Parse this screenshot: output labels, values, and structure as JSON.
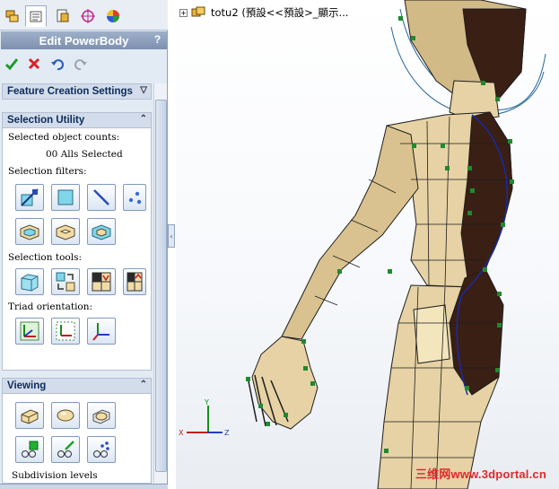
{
  "property_manager": {
    "title": "Edit PowerBody",
    "help_label": "?",
    "tabs": [
      "feature-manager-icon",
      "property-manager-icon",
      "configuration-manager-icon",
      "dimxpert-icon",
      "display-manager-icon"
    ],
    "actions": [
      "ok-icon",
      "cancel-icon",
      "undo-icon",
      "redo-icon"
    ]
  },
  "feature_creation": {
    "header": "Feature Creation Settings"
  },
  "selection_utility": {
    "header": "Selection Utility",
    "counts_label": "Selected object counts:",
    "counts_value": "00 Alls Selected",
    "filters_label": "Selection filters:",
    "filters": [
      "vertex-filter-icon",
      "face-filter-icon",
      "edge-filter-icon",
      "point-filter-icon",
      "select-loop-icon",
      "select-ring-icon",
      "select-grow-icon"
    ],
    "tools_label": "Selection tools:",
    "tools": [
      "select-box-icon",
      "select-swap-icon",
      "select-invert-icon",
      "select-grow-region-icon"
    ],
    "triad_label": "Triad orientation:",
    "triad": [
      "triad-world-icon",
      "triad-local-icon",
      "triad-view-icon"
    ]
  },
  "viewing": {
    "header": "Viewing",
    "buttons": [
      "box-view-icon",
      "smooth-view-icon",
      "both-view-icon",
      "show-vertices-icon",
      "show-edges-icon",
      "show-points-icon"
    ],
    "subdivision_label": "Subdivision levels"
  },
  "viewport": {
    "tree_expander": "+",
    "tree_root_label": "totu2 (預設<<預設>_顯示...",
    "watermark": "三维网www.3dportal.cn",
    "triad_labels": {
      "x": "X",
      "y": "Y",
      "z": "Z"
    }
  },
  "colors": {
    "panel_bg": "#e2eaf4",
    "title_bar": "#8a9cb8",
    "model_light": "#e6d2a4",
    "model_shade": "#c8ae7b",
    "model_dark": "#3a1f14",
    "mesh_vertex": "#1f8a2f",
    "watermark": "#e0282d"
  }
}
